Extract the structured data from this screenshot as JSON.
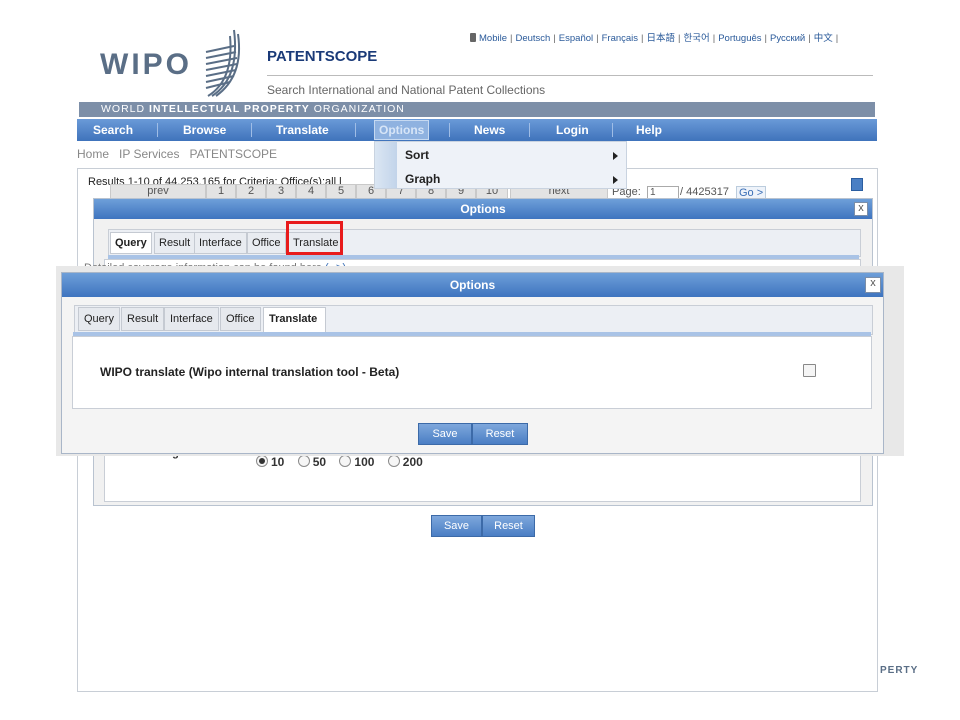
{
  "header": {
    "languages": [
      "Mobile",
      "Deutsch",
      "Español",
      "Français",
      "日本語",
      "한국어",
      "Português",
      "Русский",
      "中文"
    ],
    "logo_text": "WIPO",
    "brand_title": "PATENTSCOPE",
    "brand_subtitle": "Search International and National Patent Collections",
    "org_bar": {
      "a": "WORLD ",
      "b": "INTELLECTUAL PROPERTY",
      "c": " ORGANIZATION"
    }
  },
  "nav": {
    "items": [
      "Search",
      "Browse",
      "Translate",
      "Options",
      "News",
      "Login",
      "Help"
    ]
  },
  "breadcrumb": [
    "Home",
    "IP Services",
    "PATENTSCOPE"
  ],
  "options_menu": {
    "items": [
      "Sort",
      "Graph"
    ]
  },
  "results": {
    "text": "Results 1-10 of 44,253,165 for Criteria: Office(s):all l",
    "pager": [
      "prev",
      "1",
      "2",
      "3",
      "4",
      "5",
      "6",
      "7",
      "8",
      "9",
      "10",
      "next"
    ],
    "page_label": "Page:",
    "page_value": "1",
    "page_total": "/ 4425317",
    "go": "Go >",
    "coverage_text": "Detailed coverage information can be found here",
    "coverage_link": "(-->)"
  },
  "dialog_back": {
    "title": "Options",
    "tabs": [
      "Query",
      "Result",
      "Interface",
      "Office",
      "Translate"
    ],
    "active_tab": "Query",
    "list_length_label": "List Length",
    "list_length_options": [
      "10",
      "50",
      "100",
      "200"
    ],
    "list_length_selected": "10",
    "save": "Save",
    "reset": "Reset",
    "close": "x"
  },
  "dialog_front": {
    "title": "Options",
    "tabs": [
      "Query",
      "Result",
      "Interface",
      "Office",
      "Translate"
    ],
    "active_tab": "Translate",
    "translate_option_label": "WIPO translate (Wipo internal translation tool - Beta)",
    "translate_option_checked": false,
    "save": "Save",
    "reset": "Reset",
    "close": "x"
  },
  "footer": {
    "text": "PERTY"
  },
  "colors": {
    "nav": "#4a7fc4",
    "highlight": "#e81b1b",
    "title_blue": "#1a3a78"
  }
}
